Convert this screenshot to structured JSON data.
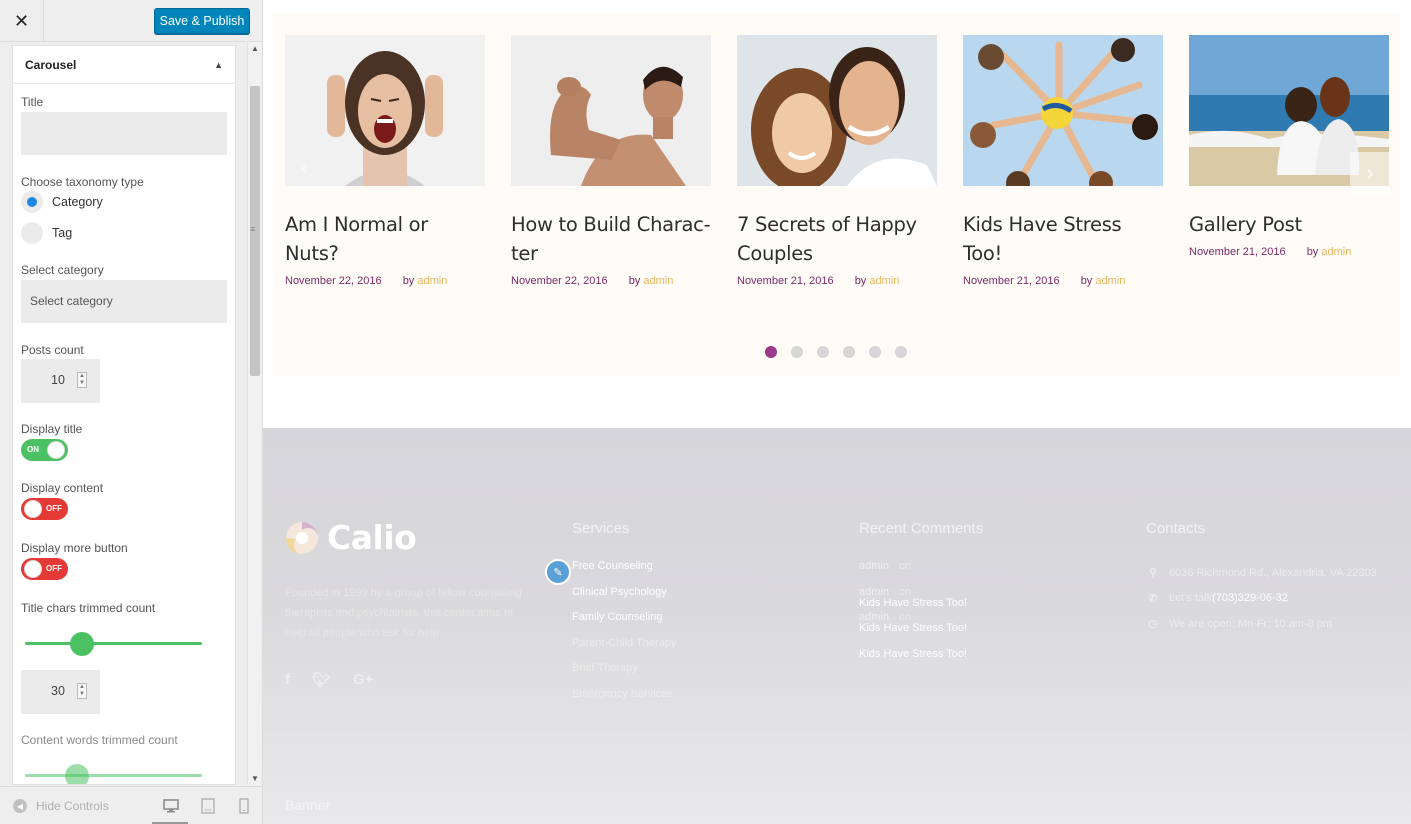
{
  "customizer": {
    "close_icon": "close-icon",
    "save_label": "Save & Publish",
    "section_title": "Carousel",
    "title_label": "Title",
    "title_value": "",
    "taxonomy_label": "Choose taxonomy type",
    "taxonomy_options": [
      "Category",
      "Tag"
    ],
    "taxonomy_selected": "Category",
    "category_label": "Select category",
    "category_placeholder": "Select category",
    "posts_count_label": "Posts count",
    "posts_count_value": "10",
    "display_title_label": "Display title",
    "display_title_state": "ON",
    "display_content_label": "Display content",
    "display_content_state": "OFF",
    "display_more_label": "Display more button",
    "display_more_state": "OFF",
    "title_trim_label": "Title chars trimmed count",
    "title_trim_value": "30",
    "content_trim_label": "Content words trimmed count",
    "hide_controls_label": "Hide Controls",
    "devices": [
      "desktop-icon",
      "tablet-icon",
      "mobile-icon"
    ],
    "active_device": "desktop"
  },
  "carousel": {
    "posts": [
      {
        "title": "Am I Normal or Nuts?",
        "date": "November 22, 2016",
        "by": "by",
        "author": "admin",
        "image": "screaming-woman-photo"
      },
      {
        "title": "How to Build Charac-ter",
        "date": "November 22, 2016",
        "by": "by",
        "author": "admin",
        "image": "flexing-man-photo"
      },
      {
        "title": "7 Secrets of Happy Couples",
        "date": "November 21, 2016",
        "by": "by",
        "author": "admin",
        "image": "smiling-couple-photo"
      },
      {
        "title": "Kids Have Stress Too!",
        "date": "November 21, 2016",
        "by": "by",
        "author": "admin",
        "image": "kids-circle-ball-photo"
      },
      {
        "title": "Gallery Post",
        "date": "November 21, 2016",
        "by": "by",
        "author": "admin",
        "image": "couple-beach-photo"
      }
    ],
    "dots_count": 6,
    "active_dot": 1
  },
  "footer": {
    "logo_text": "Calio",
    "about": "Founded in 1999 by a group of fellow counseling therapists and psychiatrists, this center aims to help all people who ask for help.",
    "social": [
      "facebook-icon",
      "twitter-icon",
      "google-plus-icon"
    ],
    "services_title": "Services",
    "services": [
      "Free Counseling",
      "Clinical Psychology",
      "Family Counseling",
      "Parent-Child Therapy",
      "Brief Therapy",
      "Emergency Services"
    ],
    "comments_title": "Recent Comments",
    "comments": [
      {
        "author": "admin",
        "on": "on",
        "post": "Kids Have Stress Too!"
      },
      {
        "author": "admin",
        "on": "on",
        "post": "Kids Have Stress Too!"
      },
      {
        "author": "admin",
        "on": "on",
        "post": "Kids Have Stress Too!"
      }
    ],
    "contacts_title": "Contacts",
    "address": "6036 Richmond Rd., Alexandria, VA 22303",
    "phone_prefix": "Let's talk",
    "phone": "(703)329-06-32",
    "hours": "We are open: Mn-Fr: 10 am-8 pm",
    "banner_label": "Banner"
  },
  "colors": {
    "accent_blue": "#0085ba",
    "toggle_on": "#4bc163",
    "toggle_off": "#e53935",
    "meta_purple": "#7a2a6a",
    "author_gold": "#e7b65b",
    "active_dot": "#9a3a8a"
  }
}
